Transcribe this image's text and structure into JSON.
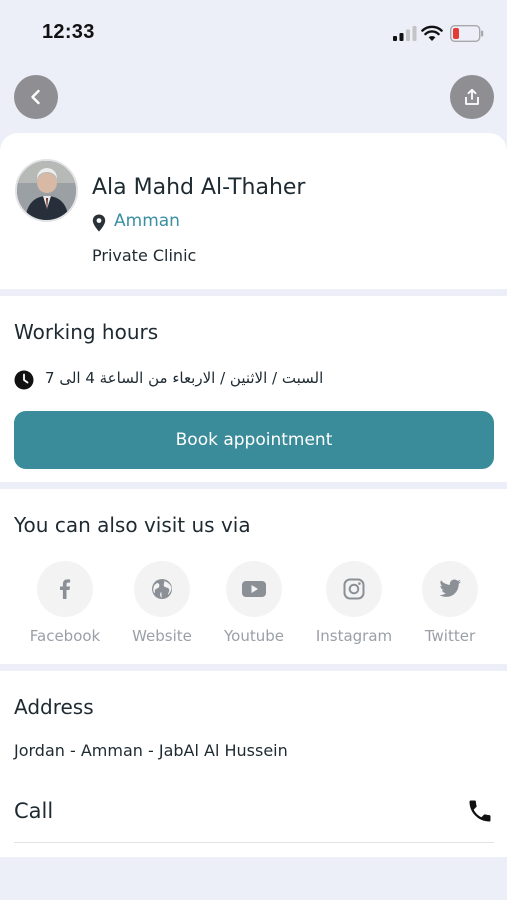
{
  "status_bar": {
    "time": "12:33"
  },
  "profile": {
    "name": "Ala Mahd Al-Thaher",
    "location": "Amman",
    "clinic_type": "Private Clinic"
  },
  "working_hours": {
    "title": "Working hours",
    "schedule": "السبت / الاثنين / الاربعاء من الساعة 4 الى 7",
    "book_button": "Book appointment"
  },
  "social": {
    "title": "You can also visit us via",
    "items": [
      {
        "label": "Facebook",
        "icon": "facebook-icon"
      },
      {
        "label": "Website",
        "icon": "globe-icon"
      },
      {
        "label": "Youtube",
        "icon": "youtube-icon"
      },
      {
        "label": "Instagram",
        "icon": "instagram-icon"
      },
      {
        "label": "Twitter",
        "icon": "twitter-icon"
      }
    ]
  },
  "address": {
    "title": "Address",
    "text": "Jordan - Amman - JabAl Al Hussein",
    "call_label": "Call"
  },
  "colors": {
    "accent": "#3a8c9a",
    "location_text": "#3a8fa1",
    "background": "#eceef8",
    "battery_low": "#e53935"
  }
}
